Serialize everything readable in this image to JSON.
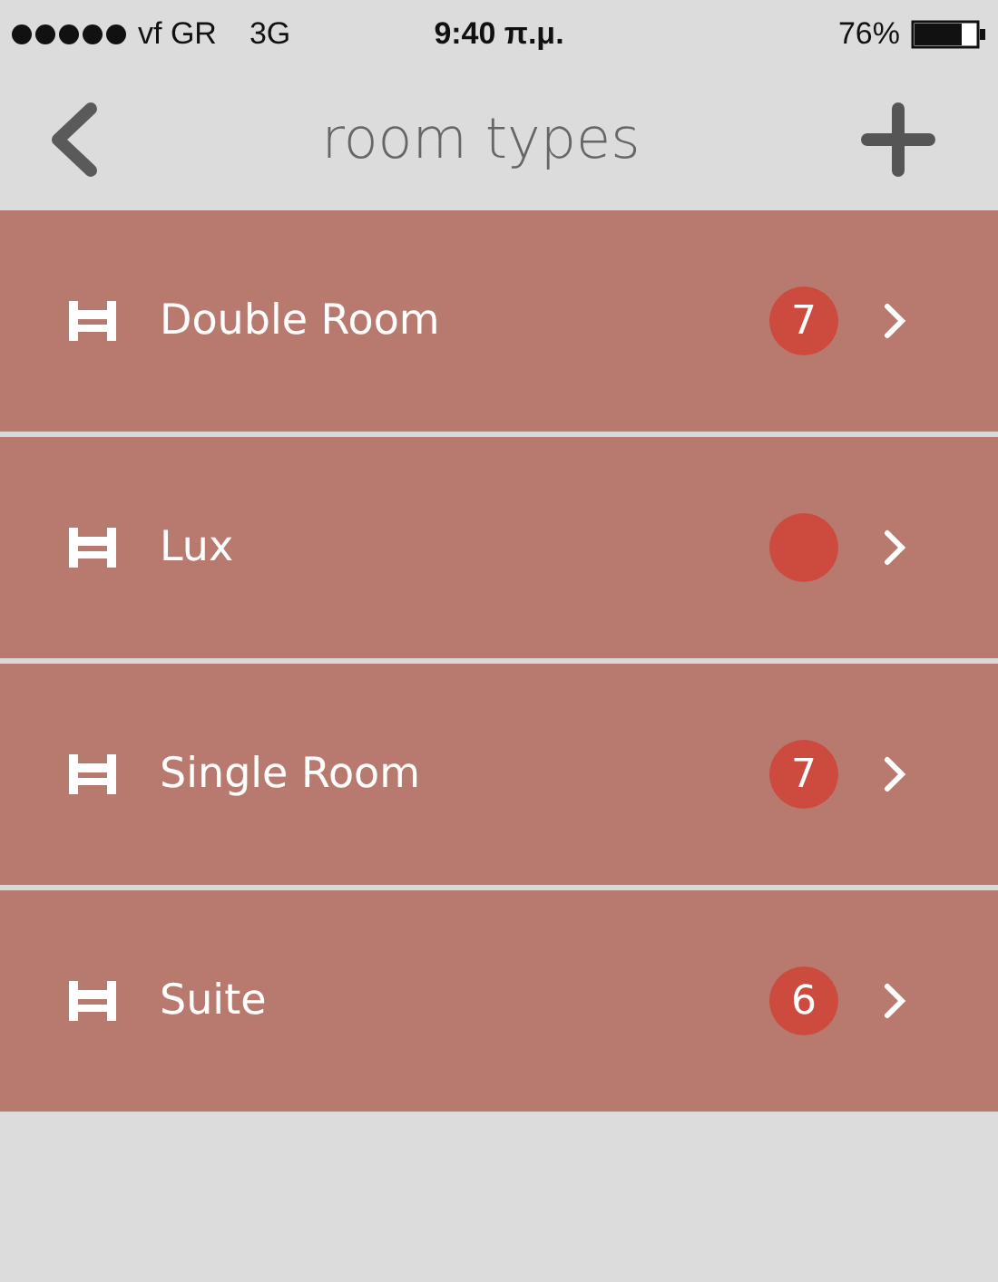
{
  "status_bar": {
    "carrier": "vf GR",
    "network": "3G",
    "time": "9:40 π.μ.",
    "battery": "76%"
  },
  "nav": {
    "title": "room types"
  },
  "rooms": [
    {
      "name": "Double Room",
      "count": "7"
    },
    {
      "name": "Lux"
    },
    {
      "name": "Single Room",
      "count": "7"
    },
    {
      "name": "Suite",
      "count": "6"
    }
  ]
}
